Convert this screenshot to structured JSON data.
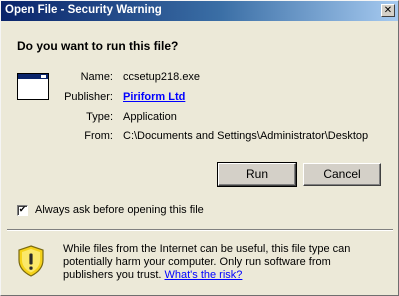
{
  "window": {
    "title": "Open File - Security Warning",
    "close_glyph": "✕"
  },
  "dialog": {
    "question": "Do you want to run this file?",
    "app_icon": "application-window-icon",
    "fields": {
      "name_label": "Name:",
      "name_value": "ccsetup218.exe",
      "publisher_label": "Publisher:",
      "publisher_value": "Piriform Ltd",
      "type_label": "Type:",
      "type_value": "Application",
      "from_label": "From:",
      "from_value": "C:\\Documents and Settings\\Administrator\\Desktop"
    },
    "buttons": {
      "run": "Run",
      "cancel": "Cancel"
    },
    "always_ask": {
      "label": "Always ask before opening this file",
      "checked": true,
      "check_glyph": "✔"
    },
    "warning": {
      "icon": "shield-warning-icon",
      "text": "While files from the Internet can be useful, this file type can potentially harm your computer. Only run software from publishers you trust.",
      "link": "What's the risk?"
    }
  },
  "colors": {
    "titlebar_start": "#0a246a",
    "titlebar_end": "#a6caf0",
    "dialog_bg": "#ece9d8",
    "link": "#0000ff",
    "shield_yellow": "#f5d21a"
  }
}
